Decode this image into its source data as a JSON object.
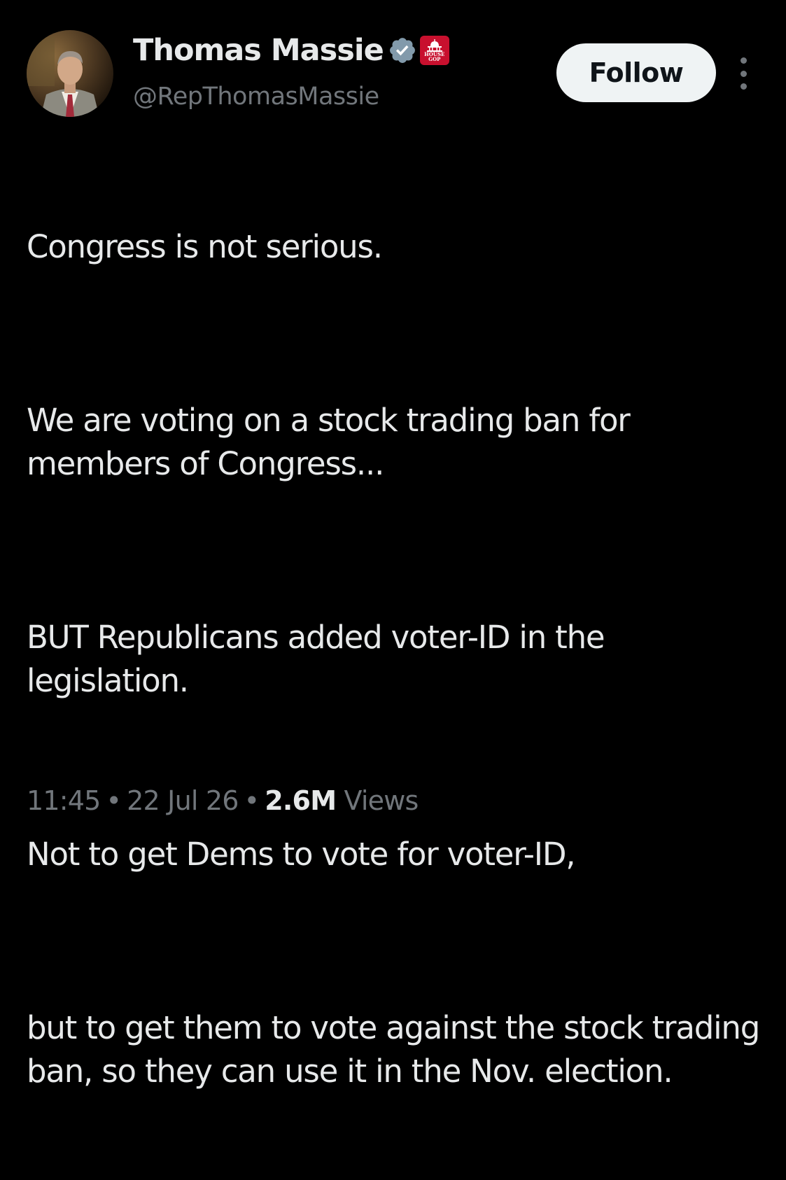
{
  "author": {
    "display_name": "Thomas Massie",
    "handle": "@RepThomasMassie",
    "verified_icon": "verified-badge-icon",
    "affiliation_badge": {
      "icon": "capitol-icon",
      "text_line1": "HOUSE",
      "text_line2": "GOP",
      "color": "#c8102e"
    }
  },
  "actions": {
    "follow_label": "Follow",
    "more_icon": "more-vertical-icon"
  },
  "body": {
    "paragraphs": [
      "Congress is not serious.",
      "We are voting on a stock trading ban for members of Congress...",
      "BUT Republicans added voter-ID in the legislation.",
      "Not to get Dems to vote for voter-ID,",
      "but to get them to vote against the stock trading ban, so they can use it in the Nov. election."
    ]
  },
  "meta": {
    "time": "11:45",
    "separator": "•",
    "date": "22 Jul 26",
    "views_count": "2.6M",
    "views_label": "Views"
  },
  "colors": {
    "background": "#000000",
    "primary_text": "#e7e9ea",
    "secondary_text": "#71767b",
    "verified_blue": "#829aab",
    "follow_button_bg": "#eff3f4"
  }
}
